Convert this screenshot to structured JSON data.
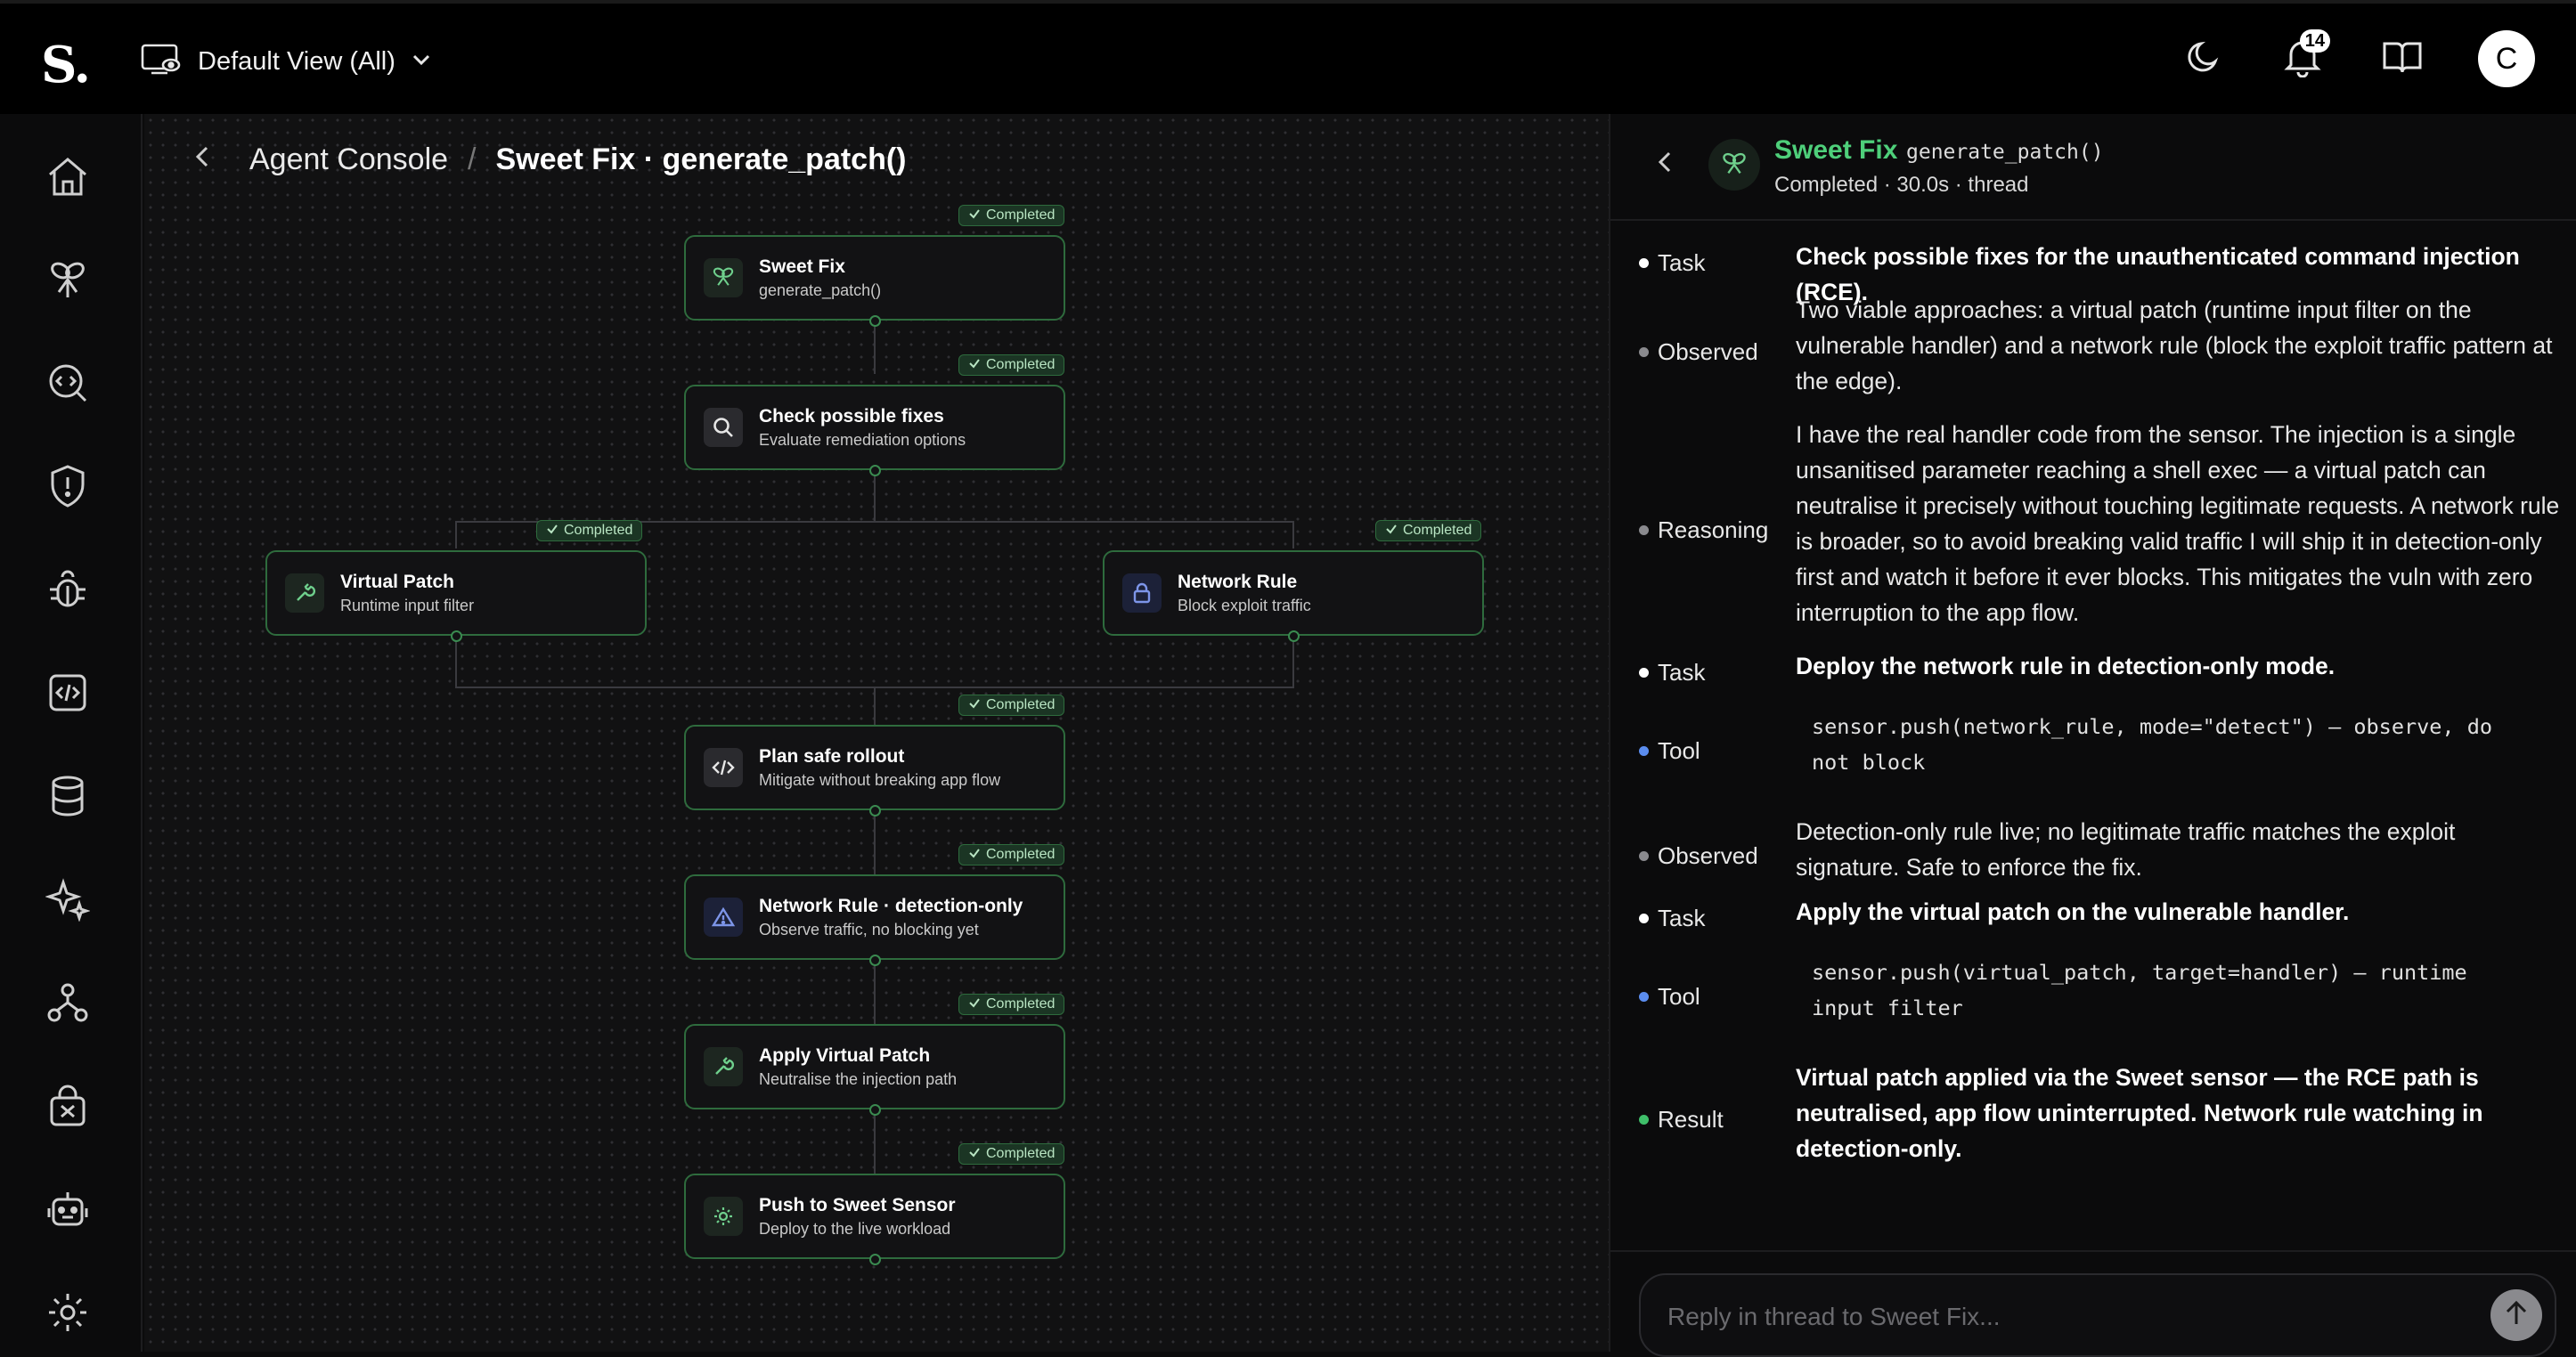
{
  "topbar": {
    "logo": "S.",
    "view_label": "Default View (All)",
    "notification_count": "14",
    "avatar_initial": "C"
  },
  "sidebar": {
    "items": [
      "home",
      "bee",
      "code-search",
      "shield",
      "bug",
      "code",
      "database",
      "sparkles",
      "network",
      "vault",
      "robot",
      "settings"
    ]
  },
  "breadcrumb": {
    "parent": "Agent Console",
    "separator": "/",
    "current": "Sweet Fix · generate_patch()"
  },
  "flow": {
    "status_label": "Completed",
    "nodes": [
      {
        "title": "Sweet Fix",
        "subtitle": "generate_patch()",
        "icon": "bee-icon"
      },
      {
        "title": "Check possible fixes",
        "subtitle": "Evaluate remediation options",
        "icon": "search-icon"
      },
      {
        "title": "Virtual Patch",
        "subtitle": "Runtime input filter",
        "icon": "wrench-icon"
      },
      {
        "title": "Network Rule",
        "subtitle": "Block exploit traffic",
        "icon": "lock-icon"
      },
      {
        "title": "Plan safe rollout",
        "subtitle": "Mitigate without breaking app flow",
        "icon": "code-icon"
      },
      {
        "title": "Network Rule · detection-only",
        "subtitle": "Observe traffic, no blocking yet",
        "icon": "warning-icon"
      },
      {
        "title": "Apply Virtual Patch",
        "subtitle": "Neutralise the injection path",
        "icon": "wrench-icon"
      },
      {
        "title": "Push to Sweet Sensor",
        "subtitle": "Deploy to the live workload",
        "icon": "gear-icon"
      }
    ]
  },
  "panel": {
    "agent_name": "Sweet Fix",
    "function": "generate_patch()",
    "meta": "Completed · 30.0s · thread",
    "colors": {
      "accent": "#4ecf7a",
      "tool": "#5b8def",
      "result": "#3fbf6a",
      "observed": "#8a8a8e",
      "task": "#ffffff"
    },
    "thread": [
      {
        "label": "Task",
        "text": "Check possible fixes for the unauthenticated command injection (RCE)."
      },
      {
        "label": "Observed",
        "text": "Two viable approaches: a virtual patch (runtime input filter on the vulnerable handler) and a network rule (block the exploit traffic pattern at the edge)."
      },
      {
        "label": "Reasoning",
        "text": "I have the real handler code from the sensor. The injection is a single unsanitised parameter reaching a shell exec — a virtual patch can neutralise it precisely without touching legitimate requests. A network rule is broader, so to avoid breaking valid traffic I will ship it in detection-only first and watch it before it ever blocks. This mitigates the vuln with zero interruption to the app flow."
      },
      {
        "label": "Task",
        "text": "Deploy the network rule in detection-only mode."
      },
      {
        "label": "Tool",
        "text": "sensor.push(network_rule, mode=\"detect\") — observe, do not block"
      },
      {
        "label": "Observed",
        "text": "Detection-only rule live; no legitimate traffic matches the exploit signature. Safe to enforce the fix."
      },
      {
        "label": "Task",
        "text": "Apply the virtual patch on the vulnerable handler."
      },
      {
        "label": "Tool",
        "text": "sensor.push(virtual_patch, target=handler) — runtime input filter"
      },
      {
        "label": "Result",
        "text": "Virtual patch applied via the Sweet sensor — the RCE path is neutralised, app flow uninterrupted. Network rule watching in detection-only."
      }
    ],
    "reply_placeholder": "Reply in thread to Sweet Fix..."
  }
}
